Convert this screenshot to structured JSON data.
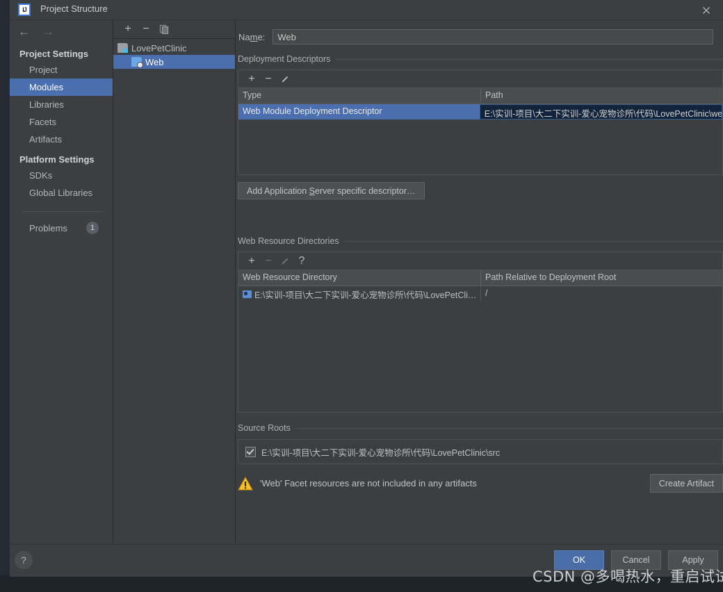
{
  "window": {
    "title": "Project Structure",
    "app_icon": "intellij-idea-icon",
    "close_icon": "close-icon"
  },
  "nav": {
    "back_icon": "arrow-left-icon",
    "forward_icon": "arrow-right-icon",
    "groups": [
      {
        "header": "Project Settings",
        "items": [
          {
            "label": "Project",
            "selected": false
          },
          {
            "label": "Modules",
            "selected": true
          },
          {
            "label": "Libraries",
            "selected": false
          },
          {
            "label": "Facets",
            "selected": false
          },
          {
            "label": "Artifacts",
            "selected": false
          }
        ]
      },
      {
        "header": "Platform Settings",
        "items": [
          {
            "label": "SDKs",
            "selected": false
          },
          {
            "label": "Global Libraries",
            "selected": false
          }
        ]
      }
    ],
    "problems": {
      "label": "Problems",
      "count": "1"
    }
  },
  "tree": {
    "toolbar": [
      {
        "name": "add-module-button",
        "glyph": "+"
      },
      {
        "name": "remove-module-button",
        "glyph": "−"
      },
      {
        "name": "copy-module-button",
        "glyph": "❐"
      }
    ],
    "nodes": [
      {
        "label": "LovePetClinic",
        "icon": "module-icon",
        "level": 0,
        "selected": false
      },
      {
        "label": "Web",
        "icon": "web-facet-icon",
        "level": 1,
        "selected": true
      }
    ]
  },
  "form": {
    "name_label_pre": "Na",
    "name_label_mnemonic": "m",
    "name_label_post": "e:",
    "name_value": "Web"
  },
  "deployment_descriptors": {
    "title": "Deployment Descriptors",
    "toolbar": [
      {
        "name": "add-descriptor-button",
        "glyph": "+",
        "enabled": true
      },
      {
        "name": "remove-descriptor-button",
        "glyph": "−",
        "enabled": true
      },
      {
        "name": "edit-descriptor-button",
        "glyph": "✎",
        "enabled": true
      }
    ],
    "columns": [
      "Type",
      "Path"
    ],
    "rows": [
      {
        "type": "Web Module Deployment Descriptor",
        "path": "E:\\实训-项目\\大二下实训-爱心宠物诊所\\代码\\LovePetClinic\\we",
        "selected": true
      }
    ],
    "add_server_descriptor_button": {
      "pre": "Add Application ",
      "mnemonic": "S",
      "post": "erver specific descriptor…"
    }
  },
  "web_resource_directories": {
    "title": "Web Resource Directories",
    "toolbar": [
      {
        "name": "add-web-resource-button",
        "glyph": "+",
        "enabled": true
      },
      {
        "name": "remove-web-resource-button",
        "glyph": "−",
        "enabled": false
      },
      {
        "name": "edit-web-resource-button",
        "glyph": "✎",
        "enabled": false
      },
      {
        "name": "help-web-resource-button",
        "glyph": "?",
        "enabled": true
      }
    ],
    "columns": [
      "Web Resource Directory",
      "Path Relative to Deployment Root"
    ],
    "rows": [
      {
        "directory": "E:\\实训-项目\\大二下实训-爱心宠物诊所\\代码\\LovePetCli…",
        "relative_path": "/",
        "icon": "folder-web-icon"
      }
    ]
  },
  "source_roots": {
    "title": "Source Roots",
    "rows": [
      {
        "checked": true,
        "path": "E:\\实训-项目\\大二下实训-爱心宠物诊所\\代码\\LovePetClinic\\src"
      }
    ]
  },
  "warning": {
    "icon": "warning-triangle-icon",
    "message": "'Web' Facet resources are not included in any artifacts",
    "action_label": "Create Artifact"
  },
  "footer": {
    "help_glyph": "?",
    "buttons": [
      {
        "label": "OK",
        "primary": true
      },
      {
        "label": "Cancel",
        "primary": false
      },
      {
        "label": "Apply",
        "primary": false
      }
    ]
  },
  "watermark": {
    "text": "CSDN @多喝热水，重启试试"
  },
  "colors": {
    "dialog_bg": "#3c3f41",
    "selection_blue": "#4b6eaf",
    "primary_button": "#4a6da7",
    "focused_cell_bg": "#12243c",
    "warning_yellow": "#f5c028"
  }
}
